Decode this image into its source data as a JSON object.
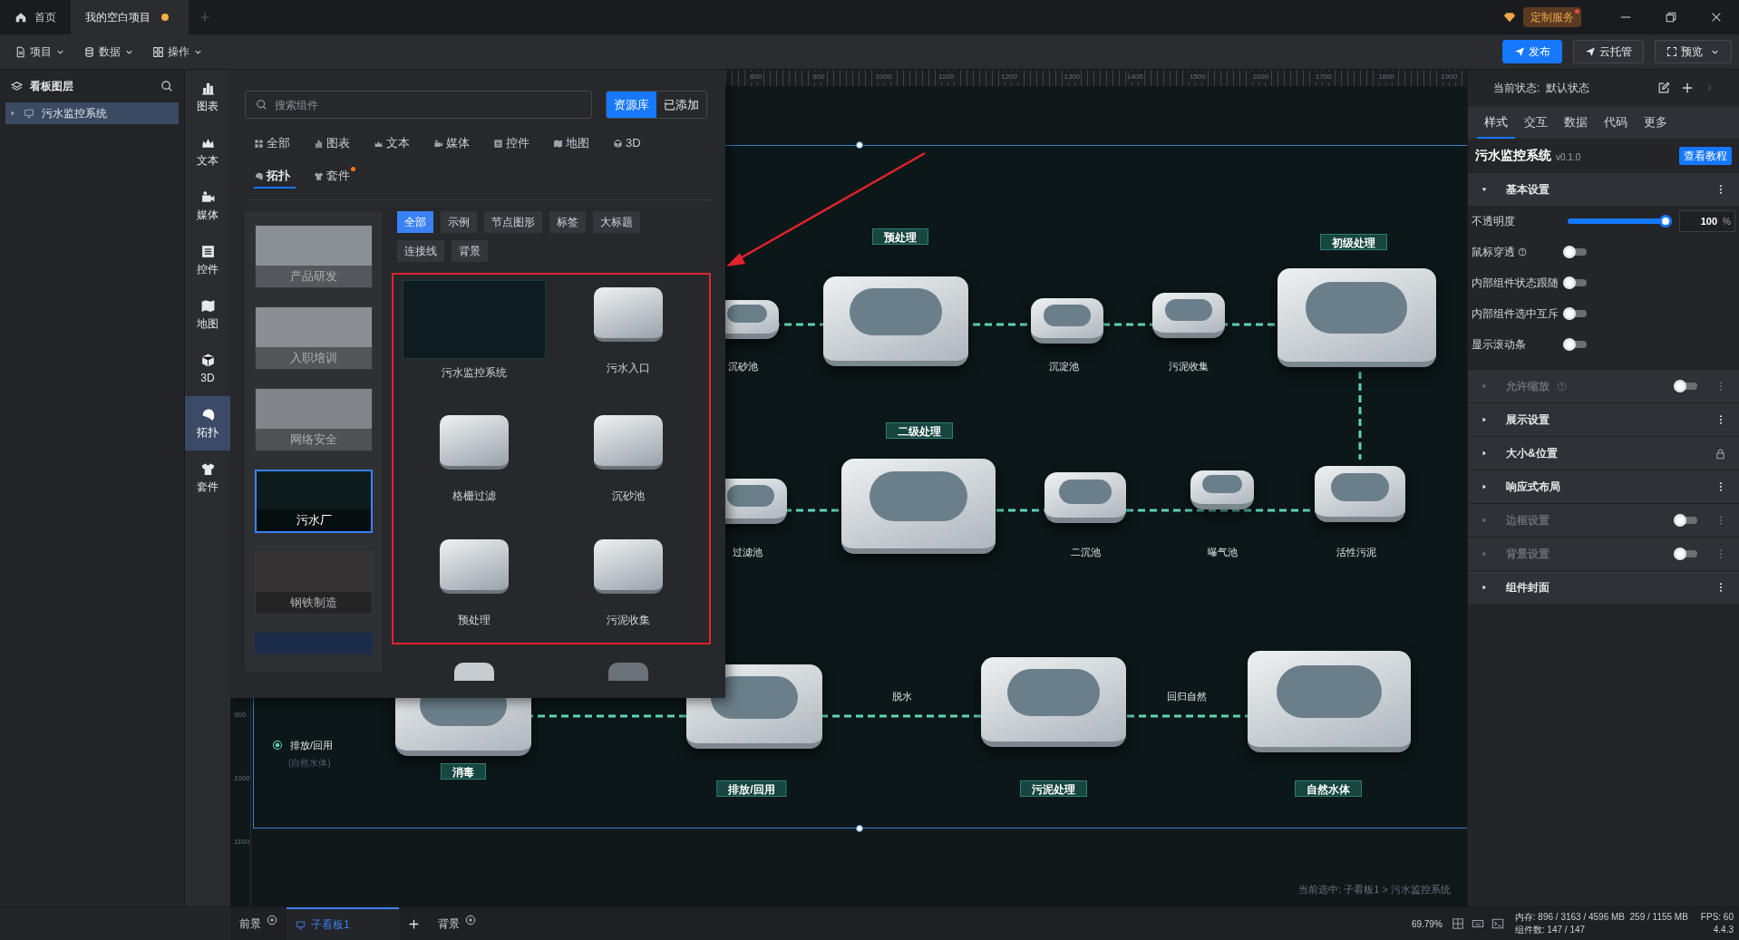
{
  "tabs": [
    {
      "label": "首页",
      "kind": "home",
      "selected": false,
      "unsaved": false
    },
    {
      "label": "我的空白项目",
      "kind": "doc",
      "selected": true,
      "unsaved": true
    }
  ],
  "service": {
    "label": "定制服务",
    "badge": true
  },
  "menus": [
    {
      "label": "项目",
      "kind": "file"
    },
    {
      "label": "数据",
      "kind": "db"
    },
    {
      "label": "操作",
      "kind": "grid"
    }
  ],
  "actions": [
    {
      "label": "发布",
      "kind": "primary"
    },
    {
      "label": "云托管",
      "kind": "secondary"
    },
    {
      "label": "预览",
      "kind": "dropdown"
    }
  ],
  "layers": {
    "title": "看板图层",
    "items": [
      {
        "label": "污水监控系统",
        "selected": true,
        "expanded": false
      }
    ]
  },
  "rail": [
    {
      "label": "图表",
      "kind": "chart",
      "selected": false
    },
    {
      "label": "文本",
      "kind": "text",
      "selected": false
    },
    {
      "label": "媒体",
      "kind": "media",
      "selected": false
    },
    {
      "label": "控件",
      "kind": "control",
      "selected": false
    },
    {
      "label": "地图",
      "kind": "map",
      "selected": false
    },
    {
      "label": "3D",
      "kind": "cube",
      "selected": false
    },
    {
      "label": "拓扑",
      "kind": "topology",
      "selected": true
    },
    {
      "label": "套件",
      "kind": "kit",
      "selected": false
    }
  ],
  "library": {
    "search": {
      "placeholder": "搜索组件"
    },
    "sources": [
      {
        "label": "资源库",
        "selected": true
      },
      {
        "label": "已添加",
        "selected": false
      }
    ],
    "categories": [
      {
        "label": "全部",
        "kind": "all",
        "selected": false,
        "badge": false
      },
      {
        "label": "图表",
        "kind": "chart",
        "selected": false,
        "badge": false
      },
      {
        "label": "文本",
        "kind": "text",
        "selected": false,
        "badge": false
      },
      {
        "label": "媒体",
        "kind": "media",
        "selected": false,
        "badge": false
      },
      {
        "label": "控件",
        "kind": "control",
        "selected": false,
        "badge": false
      },
      {
        "label": "地图",
        "kind": "map",
        "selected": false,
        "badge": false
      },
      {
        "label": "3D",
        "kind": "cube",
        "selected": false,
        "badge": false
      },
      {
        "label": "拓扑",
        "kind": "topology",
        "selected": true,
        "badge": false
      },
      {
        "label": "套件",
        "kind": "kit",
        "selected": false,
        "badge": true
      }
    ],
    "templates": [
      {
        "label": "产品研发",
        "selected": false
      },
      {
        "label": "入职培训",
        "selected": false
      },
      {
        "label": "网络安全",
        "selected": false
      },
      {
        "label": "污水厂",
        "selected": true
      },
      {
        "label": "钢铁制造",
        "selected": false
      }
    ],
    "filters": [
      {
        "label": "全部",
        "selected": true
      },
      {
        "label": "示例",
        "selected": false
      },
      {
        "label": "节点图形",
        "selected": false
      },
      {
        "label": "标签",
        "selected": false
      },
      {
        "label": "大标题",
        "selected": false
      },
      {
        "label": "连接线",
        "selected": false
      },
      {
        "label": "背景",
        "selected": false
      }
    ],
    "components": [
      {
        "label": "污水监控系统"
      },
      {
        "label": "污水入口"
      },
      {
        "label": "格栅过滤"
      },
      {
        "label": "沉砂池"
      },
      {
        "label": "预处理"
      },
      {
        "label": "污泥收集"
      }
    ]
  },
  "canvas": {
    "ruler_marks": [
      "800",
      "900",
      "1000",
      "1100",
      "1200",
      "1300",
      "1400",
      "1500",
      "1600",
      "1700",
      "1800",
      "1900"
    ],
    "side_ruler_marks": [
      "900",
      "1000",
      "1100"
    ],
    "stage_tags": [
      "预处理",
      "初级处理",
      "二级处理",
      "消毒",
      "排放/回用",
      "污泥处理",
      "自然水体"
    ],
    "captions": [
      "沉砂池",
      "沉淀池",
      "污泥收集",
      "过滤池",
      "二沉池",
      "曝气池",
      "活性污泥",
      "脱水",
      "回归自然"
    ],
    "legend": {
      "label": "排放/回用",
      "note": "(自然水体)"
    },
    "breadcrumb": "当前选中: 子看板1 > 污水监控系统"
  },
  "inspector": {
    "state": "当前状态:  默认状态",
    "tabs": [
      {
        "label": "样式",
        "selected": true
      },
      {
        "label": "交互",
        "selected": false
      },
      {
        "label": "数据",
        "selected": false
      },
      {
        "label": "代码",
        "selected": false
      },
      {
        "label": "更多",
        "selected": false
      }
    ],
    "component": {
      "name": "污水监控系统",
      "version": "v0.1.0",
      "tutorial": "查看教程"
    },
    "basic": {
      "label": "基本设置",
      "expanded": true,
      "rows": [
        {
          "kind": "slider",
          "label": "不透明度",
          "level": 1,
          "value": "100",
          "unit": "%"
        },
        {
          "kind": "toggle",
          "label": "鼠标穿透",
          "help": true,
          "on": false
        },
        {
          "kind": "toggle",
          "label": "内部组件状态跟随",
          "help": false,
          "on": false
        },
        {
          "kind": "toggle",
          "label": "内部组件选中互斥",
          "help": false,
          "on": false
        },
        {
          "kind": "toggle",
          "label": "显示滚动条",
          "help": false,
          "on": false
        }
      ]
    },
    "sections": [
      {
        "label": "允许缩放",
        "kind": "toggle",
        "disabled": true,
        "help": true,
        "on": false,
        "expanded": false
      },
      {
        "label": "展示设置",
        "kind": "menu",
        "disabled": false,
        "help": false,
        "expanded": false
      },
      {
        "label": "大小&位置",
        "kind": "lock",
        "disabled": false,
        "help": false,
        "expanded": false
      },
      {
        "label": "响应式布局",
        "kind": "menu",
        "disabled": false,
        "help": false,
        "expanded": false
      },
      {
        "label": "边框设置",
        "kind": "toggle",
        "disabled": true,
        "help": false,
        "on": false,
        "expanded": false
      },
      {
        "label": "背景设置",
        "kind": "toggle",
        "disabled": true,
        "help": false,
        "on": false,
        "expanded": false
      },
      {
        "label": "组件封面",
        "kind": "menu",
        "disabled": false,
        "help": false,
        "expanded": false
      }
    ]
  },
  "footer": {
    "tabs": [
      {
        "label": "前景",
        "kind": "layer",
        "selected": false
      },
      {
        "label": "子看板1",
        "kind": "board",
        "selected": true
      },
      {
        "label": "背景",
        "kind": "layer",
        "selected": false
      }
    ],
    "zoom": "69.79%",
    "memory": "内存: 896 / 3163 / 4596 MB  259 / 1155 MB",
    "fps": "FPS: 60",
    "count": "组件数: 147 / 147",
    "version": "4.4.3"
  }
}
